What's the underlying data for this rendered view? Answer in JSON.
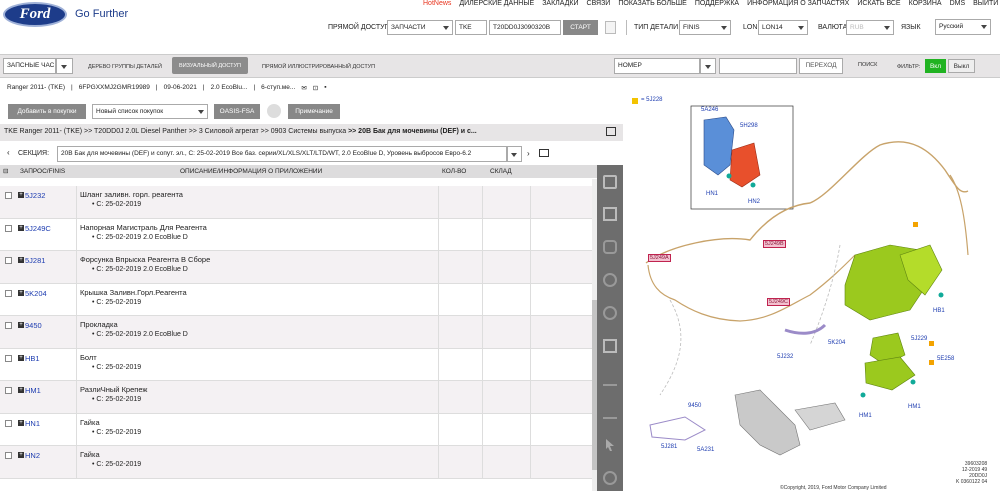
{
  "header": {
    "logo": "Ford",
    "tagline": "Go Further",
    "nav": [
      "HotNews",
      "ДИЛЕРСКИЕ ДАННЫЕ",
      "ЗАКЛАДКИ",
      "СВЯЗИ",
      "ПОКАЗАТЬ БОЛЬШЕ",
      "ПОДДЕРЖКА",
      "ИНФОРМАЦИЯ О ЗАПЧАСТЯХ",
      "ИСКАТЬ ВСЕ",
      "КОРЗИНА",
      "DMS",
      "ВЫЙТИ"
    ]
  },
  "access": {
    "label": "ПРЯМОЙ ДОСТУП",
    "type": "ЗАПЧАСТИ",
    "catalog": "TKE",
    "vin": "T20DD0J3090320B",
    "start": "СТАРТ",
    "part_type_label": "ТИП ДЕТАЛИ",
    "part_type": "FINIS",
    "lon_label": "LON",
    "lon": "LON14",
    "currency_label": "ВАЛЮТА",
    "currency": "RUB",
    "lang_label": "ЯЗЫК",
    "lang": "Русский"
  },
  "tabs": {
    "mode": "ЗАПСНЫЕ ЧАС",
    "tree": "ДЕРЕВО ГРУППЫ ДЕТАЛЕЙ",
    "visual": "ВИЗУАЛЬНЫЙ ДОСТУП",
    "illustrated": "ПРЯМОЙ ИЛЛЮСТРИРОВАННЫЙ ДОСТУП",
    "search_type": "НОМЕР",
    "go": "ПЕРЕХОД",
    "search": "ПОИСК",
    "filter": "ФИЛЬТР:",
    "on": "Вкл",
    "off": "Выкл"
  },
  "vehicle": {
    "model": "Ranger 2011- (TKE)",
    "vin": "6FPGXXMJ2GMR19989",
    "date": "09-06-2021",
    "engine": "2.0 EcoBlu...",
    "trans": "6-ступ.ме..."
  },
  "actions": {
    "add": "Добавить в покупки",
    "new_list": "Новый список покупок",
    "oasis": "OASIS-FSA",
    "note": "Примечание"
  },
  "breadcrumb": [
    "TKE Ranger 2011- (TKE)",
    ">> T20DD0J 2.0L Diesel Panther",
    ">> 3 Силовой агрегат",
    ">> 0903 Системы выпуска",
    ">> 20В Бак для мочевины (DEF) и с..."
  ],
  "section": {
    "label": "СЕКЦИЯ:",
    "value": "20В Бак для мочевины (DEF) и сопут. эл., С: 25-02-2019 Все баз. серии/XL/XLS/XLT/LTD/WT, 2.0 EcoBlue D, Уровень выбросов Евро-6.2"
  },
  "table": {
    "headers": [
      "ЗАПРОС/FINIS",
      "ОПИСАНИЕ/ИНФОРМАЦИЯ О ПРИЛОЖЕНИИ",
      "КОЛ-ВО",
      "СКЛАД"
    ],
    "rows": [
      {
        "code": "5J232",
        "desc": "Шланг заливн. горл. реагента",
        "sub": "С: 25-02-2019"
      },
      {
        "code": "5J249C",
        "desc": "Напорная Магистраль Для Реагента",
        "sub": "С: 25-02-2019 2.0 EcoBlue D"
      },
      {
        "code": "5J281",
        "desc": "Форсунка Впрыска Реагента В Сборе",
        "sub": "С: 25-02-2019 2.0 EcoBlue D"
      },
      {
        "code": "5K204",
        "desc": "Крышка Заливн.Горл.Реагента",
        "sub": "С: 25-02-2019"
      },
      {
        "code": "9450",
        "desc": "Прокладка",
        "sub": "С: 25-02-2019 2.0 EcoBlue D"
      },
      {
        "code": "HB1",
        "desc": "Болт",
        "sub": "С: 25-02-2019"
      },
      {
        "code": "HM1",
        "desc": "РазлиЧный Крепеж",
        "sub": "С: 25-02-2019"
      },
      {
        "code": "HN1",
        "desc": "Гайка",
        "sub": "С: 25-02-2019"
      },
      {
        "code": "HN2",
        "desc": "Гайка",
        "sub": "С: 25-02-2019"
      }
    ]
  },
  "diagram": {
    "legend": "= 5J228",
    "labels": [
      "5A246",
      "5H298",
      "HN1",
      "HN2",
      "5J249A",
      "5J249B",
      "5J249C",
      "5J232",
      "5K204",
      "HB1",
      "5J229",
      "5E258",
      "HM1",
      "HM1",
      "9450",
      "5J281",
      "5A231"
    ],
    "copyright": "©Copyright, 2019, Ford Motor Company Limited",
    "refcode": [
      "39603208",
      "12-2019 49",
      "20DD0J",
      "K 0360122 04"
    ]
  }
}
